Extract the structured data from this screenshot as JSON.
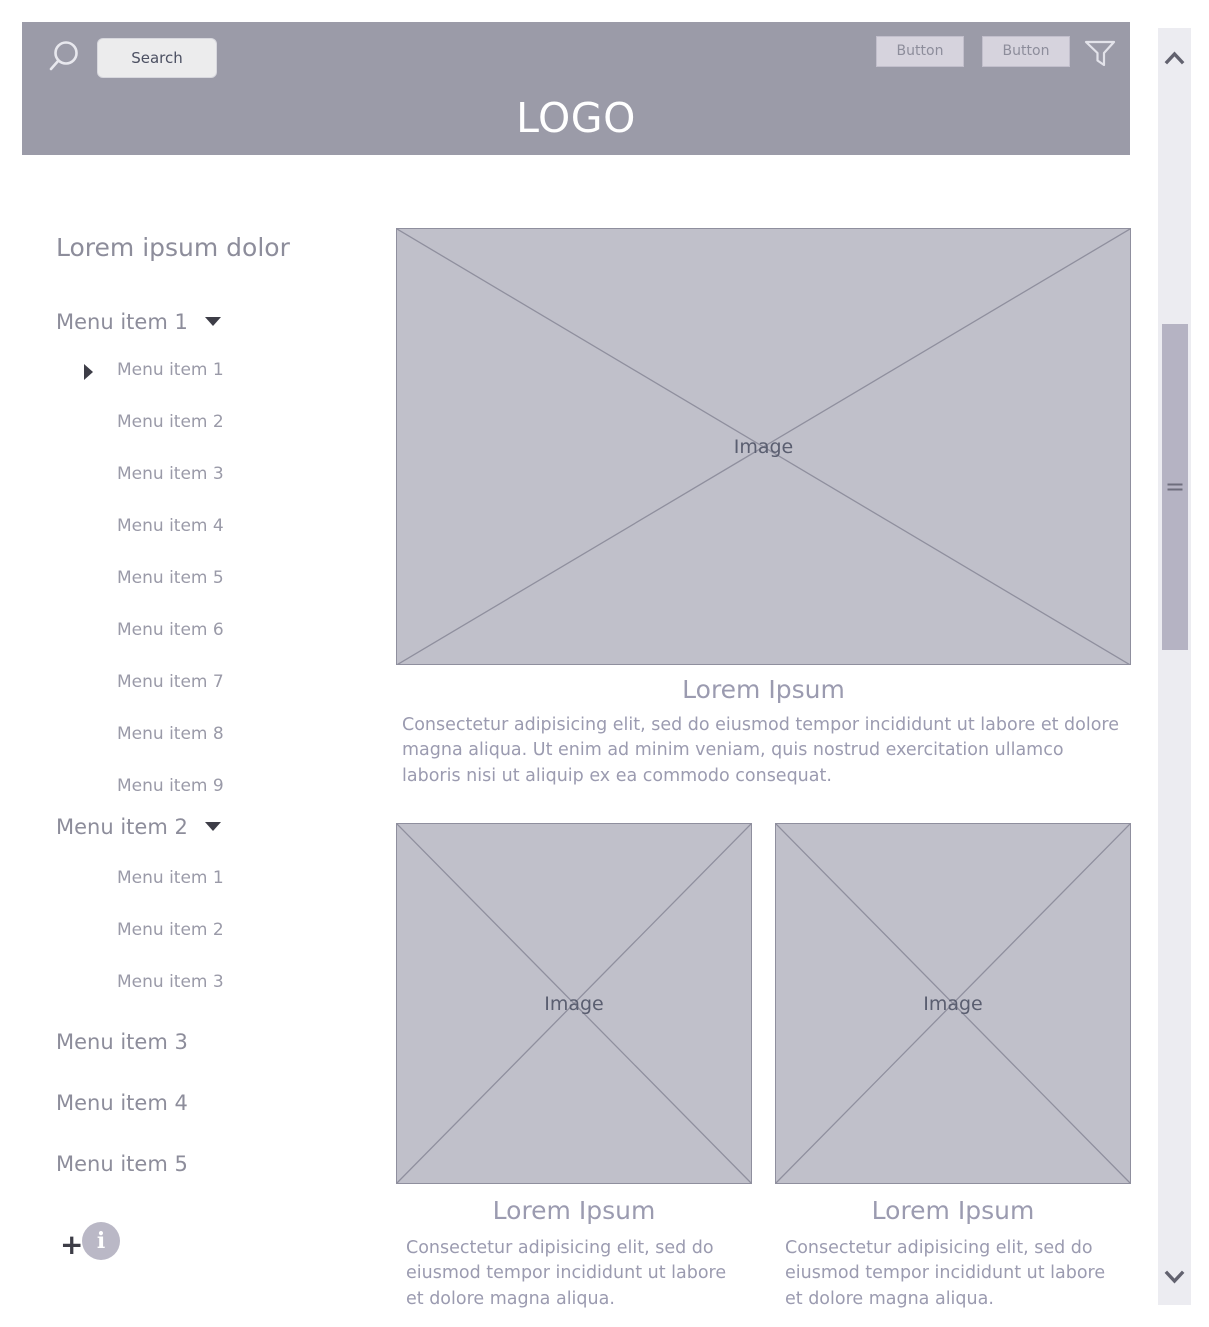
{
  "header": {
    "search": {
      "icon": "search-icon",
      "value": "Search",
      "placeholder": "Search"
    },
    "buttons": [
      {
        "label": "Button"
      },
      {
        "label": "Button"
      }
    ],
    "filter_icon": "filter-icon",
    "logo": "LOGO",
    "background_color": "#9b9ba8"
  },
  "sidebar": {
    "heading": "Lorem ipsum dolor",
    "groups": [
      {
        "label": "Menu item 1",
        "expanded": true,
        "caret": "chevron-down-icon",
        "items": [
          {
            "label": "Menu item 1",
            "marker": "caret-right-icon"
          },
          {
            "label": "Menu item 2"
          },
          {
            "label": "Menu item 3"
          },
          {
            "label": "Menu item 4"
          },
          {
            "label": "Menu item 5"
          },
          {
            "label": "Menu item 6"
          },
          {
            "label": "Menu item 7"
          },
          {
            "label": "Menu item 8"
          },
          {
            "label": "Menu item 9"
          }
        ]
      },
      {
        "label": "Menu item 2",
        "expanded": true,
        "caret": "chevron-down-icon",
        "items": [
          {
            "label": "Menu item 1"
          },
          {
            "label": "Menu item 2"
          },
          {
            "label": "Menu item 3"
          }
        ]
      },
      {
        "label": "Menu item 3",
        "expanded": false,
        "items": []
      },
      {
        "label": "Menu item 4",
        "expanded": false,
        "items": []
      },
      {
        "label": "Menu item 5",
        "expanded": false,
        "items": []
      }
    ],
    "footer": {
      "add": "+",
      "info": "i"
    }
  },
  "main": {
    "hero": {
      "image_label": "Image",
      "title": "Lorem Ipsum",
      "body": "Consectetur adipisicing elit, sed do eiusmod tempor incididunt ut labore et dolore magna aliqua. Ut enim ad minim veniam, quis nostrud exercitation ullamco laboris nisi ut aliquip ex ea commodo consequat."
    },
    "cards": [
      {
        "image_label": "Image",
        "title": "Lorem Ipsum",
        "body": "Consectetur adipisicing elit, sed do eiusmod tempor incididunt ut labore et dolore magna aliqua."
      },
      {
        "image_label": "Image",
        "title": "Lorem Ipsum",
        "body": "Consectetur adipisicing elit, sed do eiusmod tempor incididunt ut labore et dolore magna aliqua."
      }
    ]
  },
  "scrollbar": {
    "up_icon": "chevron-up-icon",
    "down_icon": "chevron-down-icon",
    "grip_icon": "grip-lines-icon",
    "thumb_color": "#b5b3c3",
    "track_color": "#ececf1"
  }
}
